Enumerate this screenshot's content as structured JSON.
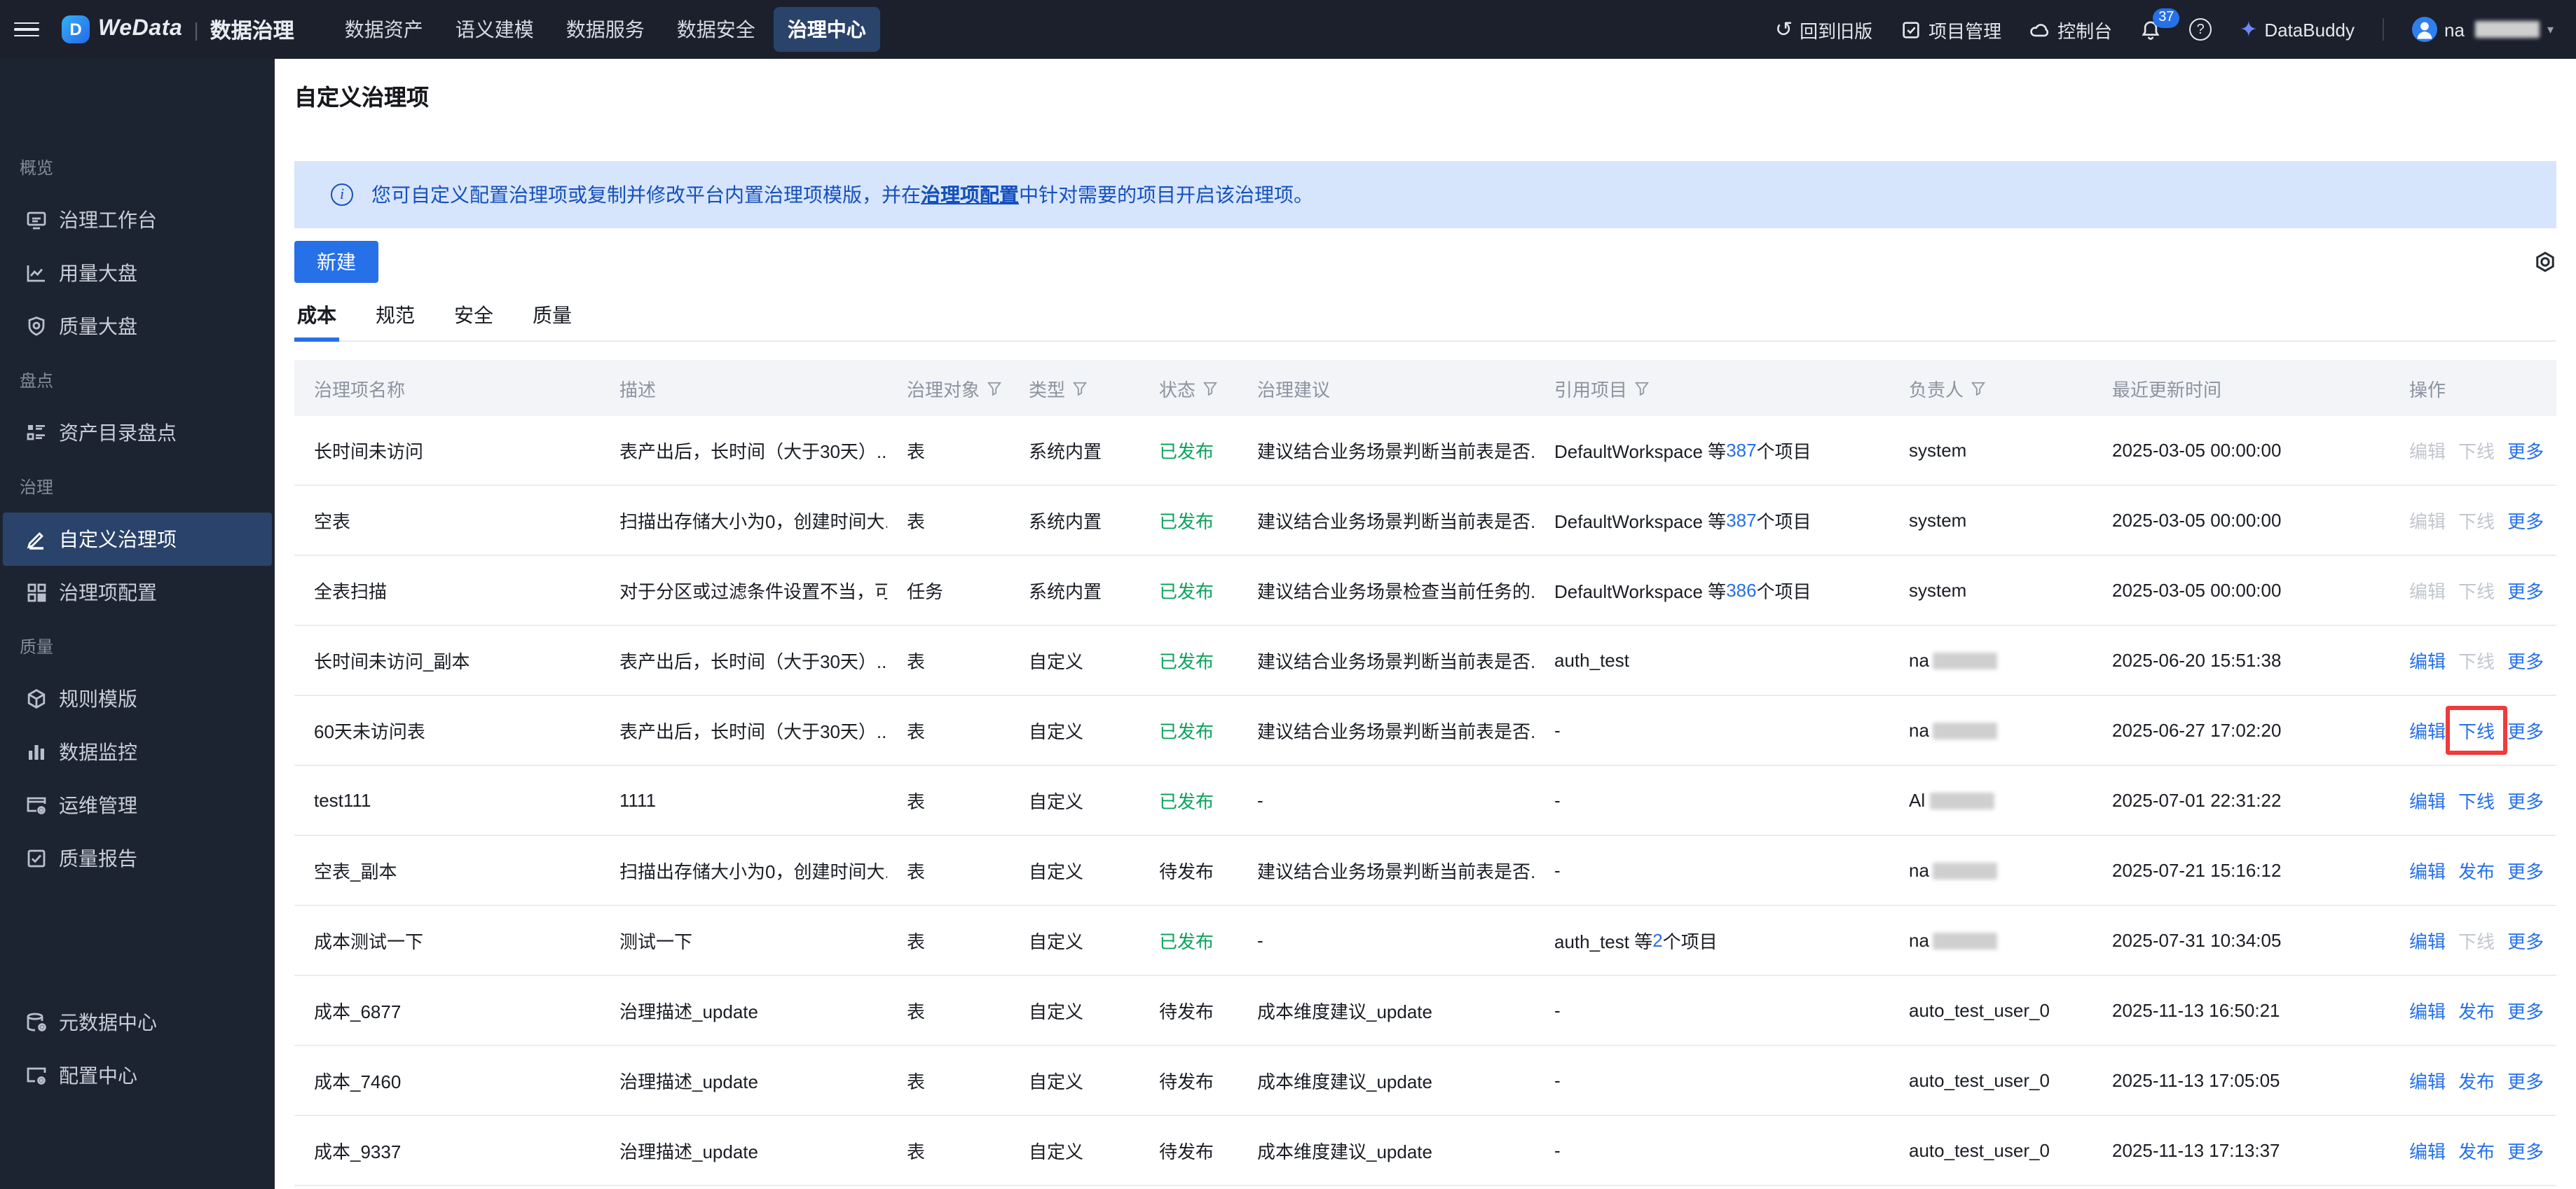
{
  "topnav": {
    "logo": "WeData",
    "logo_letter": "D",
    "divider": "|",
    "product": "数据治理",
    "menu": [
      "数据资产",
      "语义建模",
      "数据服务",
      "数据安全",
      "治理中心"
    ],
    "right": {
      "back_old": "回到旧版",
      "project_mgmt": "项目管理",
      "console": "控制台",
      "notif_count": "37",
      "help": "?",
      "databuddy": "DataBuddy",
      "username": "na"
    }
  },
  "sidebar": {
    "sections": [
      {
        "label": "概览",
        "items": [
          {
            "label": "治理工作台"
          },
          {
            "label": "用量大盘"
          },
          {
            "label": "质量大盘"
          }
        ]
      },
      {
        "label": "盘点",
        "items": [
          {
            "label": "资产目录盘点"
          }
        ]
      },
      {
        "label": "治理",
        "items": [
          {
            "label": "自定义治理项"
          },
          {
            "label": "治理项配置"
          }
        ]
      },
      {
        "label": "质量",
        "items": [
          {
            "label": "规则模版"
          },
          {
            "label": "数据监控"
          },
          {
            "label": "运维管理"
          },
          {
            "label": "质量报告"
          }
        ]
      }
    ],
    "bottom_items": [
      {
        "label": "元数据中心"
      },
      {
        "label": "配置中心"
      }
    ]
  },
  "page": {
    "title": "自定义治理项",
    "banner": {
      "prefix": "您可自定义配置治理项或复制并修改平台内置治理项模版，并在",
      "link": "治理项配置",
      "suffix": "中针对需要的项目开启该治理项。"
    },
    "create_button": "新建",
    "tabs": [
      "成本",
      "规范",
      "安全",
      "质量"
    ],
    "table": {
      "headers": [
        "治理项名称",
        "描述",
        "治理对象",
        "类型",
        "状态",
        "治理建议",
        "引用项目",
        "负责人",
        "最近更新时间",
        "操作"
      ],
      "rows": [
        {
          "name": "长时间未访问",
          "desc": "表产出后，长时间（大于30天）...",
          "object": "表",
          "type": "系统内置",
          "status": "已发布",
          "status_class": "green",
          "suggestion": "建议结合业务场景判断当前表是否...",
          "projects_text": "DefaultWorkspace 等",
          "projects_link": "387",
          "projects_suffix": "个项目",
          "owner": "system",
          "owner_redacted": false,
          "updated": "2025-03-05 00:00:00",
          "edit": "编辑",
          "edit_class": "disabled",
          "toggle": "下线",
          "toggle_class": "disabled",
          "more": "更多",
          "more_class": ""
        },
        {
          "name": "空表",
          "desc": "扫描出存储大小为0，创建时间大...",
          "object": "表",
          "type": "系统内置",
          "status": "已发布",
          "status_class": "green",
          "suggestion": "建议结合业务场景判断当前表是否...",
          "projects_text": "DefaultWorkspace 等",
          "projects_link": "387",
          "projects_suffix": "个项目",
          "owner": "system",
          "owner_redacted": false,
          "updated": "2025-03-05 00:00:00",
          "edit": "编辑",
          "edit_class": "disabled",
          "toggle": "下线",
          "toggle_class": "disabled",
          "more": "更多",
          "more_class": ""
        },
        {
          "name": "全表扫描",
          "desc": "对于分区或过滤条件设置不当，可...",
          "object": "任务",
          "type": "系统内置",
          "status": "已发布",
          "status_class": "green",
          "suggestion": "建议结合业务场景检查当前任务的...",
          "projects_text": "DefaultWorkspace 等",
          "projects_link": "386",
          "projects_suffix": "个项目",
          "owner": "system",
          "owner_redacted": false,
          "updated": "2025-03-05 00:00:00",
          "edit": "编辑",
          "edit_class": "disabled",
          "toggle": "下线",
          "toggle_class": "disabled",
          "more": "更多",
          "more_class": ""
        },
        {
          "name": "长时间未访问_副本",
          "desc": "表产出后，长时间（大于30天）...",
          "object": "表",
          "type": "自定义",
          "status": "已发布",
          "status_class": "green",
          "suggestion": "建议结合业务场景判断当前表是否...",
          "projects_text": "auth_test",
          "projects_link": "",
          "projects_suffix": "",
          "owner": "na",
          "owner_redacted": true,
          "updated": "2025-06-20 15:51:38",
          "edit": "编辑",
          "edit_class": "",
          "toggle": "下线",
          "toggle_class": "disabled",
          "more": "更多",
          "more_class": ""
        },
        {
          "name": "60天未访问表",
          "desc": "表产出后，长时间（大于30天）...",
          "object": "表",
          "type": "自定义",
          "status": "已发布",
          "status_class": "green",
          "suggestion": "建议结合业务场景判断当前表是否...",
          "projects_text": "-",
          "projects_link": "",
          "projects_suffix": "",
          "owner": "na",
          "owner_redacted": true,
          "updated": "2025-06-27 17:02:20",
          "edit": "编辑",
          "edit_class": "",
          "toggle": "下线",
          "toggle_class": "hl",
          "more": "更多",
          "more_class": ""
        },
        {
          "name": "test111",
          "desc": "1111",
          "object": "表",
          "type": "自定义",
          "status": "已发布",
          "status_class": "green",
          "suggestion": "-",
          "projects_text": "-",
          "projects_link": "",
          "projects_suffix": "",
          "owner": "Al",
          "owner_redacted": true,
          "updated": "2025-07-01 22:31:22",
          "edit": "编辑",
          "edit_class": "",
          "toggle": "下线",
          "toggle_class": "",
          "more": "更多",
          "more_class": ""
        },
        {
          "name": "空表_副本",
          "desc": "扫描出存储大小为0，创建时间大...",
          "object": "表",
          "type": "自定义",
          "status": "待发布",
          "status_class": "",
          "suggestion": "建议结合业务场景判断当前表是否...",
          "projects_text": "-",
          "projects_link": "",
          "projects_suffix": "",
          "owner": "na",
          "owner_redacted": true,
          "updated": "2025-07-21 15:16:12",
          "edit": "编辑",
          "edit_class": "",
          "toggle": "发布",
          "toggle_class": "",
          "more": "更多",
          "more_class": ""
        },
        {
          "name": "成本测试一下",
          "desc": "测试一下",
          "object": "表",
          "type": "自定义",
          "status": "已发布",
          "status_class": "green",
          "suggestion": "-",
          "projects_text": "auth_test 等",
          "projects_link": "2",
          "projects_suffix": "个项目",
          "owner": "na",
          "owner_redacted": true,
          "updated": "2025-07-31 10:34:05",
          "edit": "编辑",
          "edit_class": "",
          "toggle": "下线",
          "toggle_class": "disabled",
          "more": "更多",
          "more_class": ""
        },
        {
          "name": "成本_6877",
          "desc": "治理描述_update",
          "object": "表",
          "type": "自定义",
          "status": "待发布",
          "status_class": "",
          "suggestion": "成本维度建议_update",
          "projects_text": "-",
          "projects_link": "",
          "projects_suffix": "",
          "owner": "auto_test_user_0",
          "owner_redacted": false,
          "updated": "2025-11-13 16:50:21",
          "edit": "编辑",
          "edit_class": "",
          "toggle": "发布",
          "toggle_class": "",
          "more": "更多",
          "more_class": ""
        },
        {
          "name": "成本_7460",
          "desc": "治理描述_update",
          "object": "表",
          "type": "自定义",
          "status": "待发布",
          "status_class": "",
          "suggestion": "成本维度建议_update",
          "projects_text": "-",
          "projects_link": "",
          "projects_suffix": "",
          "owner": "auto_test_user_0",
          "owner_redacted": false,
          "updated": "2025-11-13 17:05:05",
          "edit": "编辑",
          "edit_class": "",
          "toggle": "发布",
          "toggle_class": "",
          "more": "更多",
          "more_class": ""
        },
        {
          "name": "成本_9337",
          "desc": "治理描述_update",
          "object": "表",
          "type": "自定义",
          "status": "待发布",
          "status_class": "",
          "suggestion": "成本维度建议_update",
          "projects_text": "-",
          "projects_link": "",
          "projects_suffix": "",
          "owner": "auto_test_user_0",
          "owner_redacted": false,
          "updated": "2025-11-13 17:13:37",
          "edit": "编辑",
          "edit_class": "",
          "toggle": "发布",
          "toggle_class": "",
          "more": "更多",
          "more_class": ""
        }
      ]
    }
  },
  "colors": {
    "accent_blue": "#2670E8",
    "success_green": "#0AA35B",
    "highlight_red": "#F03B3B",
    "banner_text_blue": "#1450BE",
    "nav_bg": "#1B202C",
    "sidebar_bg": "#1D2431"
  }
}
